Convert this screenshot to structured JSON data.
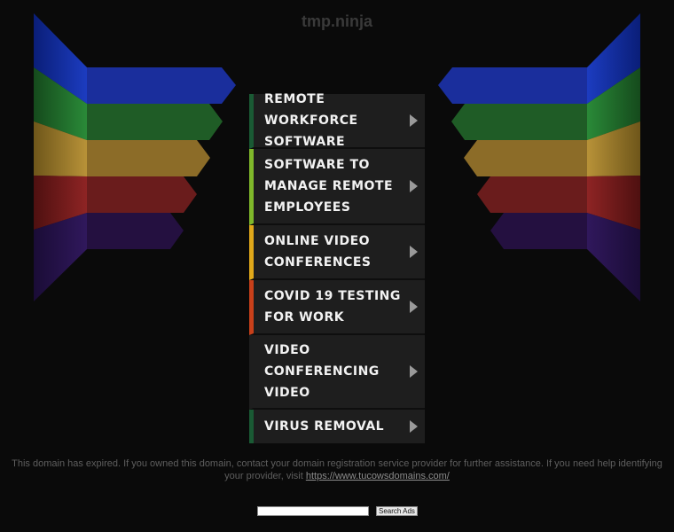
{
  "header": {
    "site_title": "tmp.ninja"
  },
  "colors": {
    "blue": "#0d2a9e",
    "green": "#1f6b2a",
    "gold": "#9c7a2a",
    "red": "#7a1e1e",
    "purple": "#2a1450",
    "accent_green": "#1a5a34",
    "accent_lime": "#7fb82a",
    "accent_yellow": "#e0a81a",
    "accent_orange": "#c8401a"
  },
  "menu": {
    "items": [
      {
        "label": "Remote Workforce Software",
        "accent": "#1a5a34"
      },
      {
        "label": "Software to Manage Remote Employees",
        "accent": "#7fb82a"
      },
      {
        "label": "Online Video Conferences",
        "accent": "#e0a81a"
      },
      {
        "label": "Covid 19 Testing for Work",
        "accent": "#c8401a"
      },
      {
        "label": "Video Conferencing Video",
        "accent": "#1e1e1e"
      },
      {
        "label": "Virus Removal",
        "accent": "#1a5a34"
      }
    ]
  },
  "notice": {
    "text": "This domain has expired. If you owned this domain, contact your domain registration service provider for further assistance. If you need help identifying your provider, visit ",
    "link_text": "https://www.tucowsdomains.com/"
  },
  "search": {
    "placeholder": "",
    "button_label": "Search Ads"
  }
}
